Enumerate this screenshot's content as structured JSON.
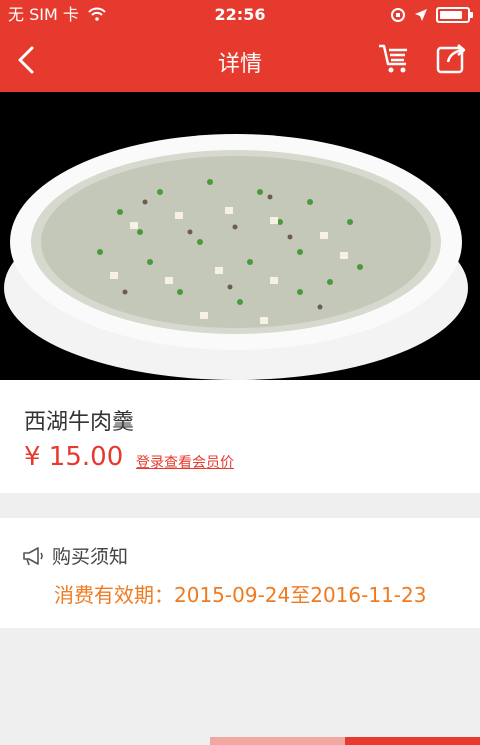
{
  "status_bar": {
    "carrier": "无 SIM 卡",
    "time": "22:56"
  },
  "nav": {
    "title": "详情"
  },
  "product": {
    "name": "西湖牛肉羹",
    "price": "¥ 15.00",
    "member_price_link": "登录查看会员价"
  },
  "notice": {
    "title": "购买须知",
    "validity": "消费有效期：2015-09-24至2016-11-23"
  },
  "colors": {
    "brand_red": "#e63a2e",
    "notice_orange": "#f07a1f"
  }
}
